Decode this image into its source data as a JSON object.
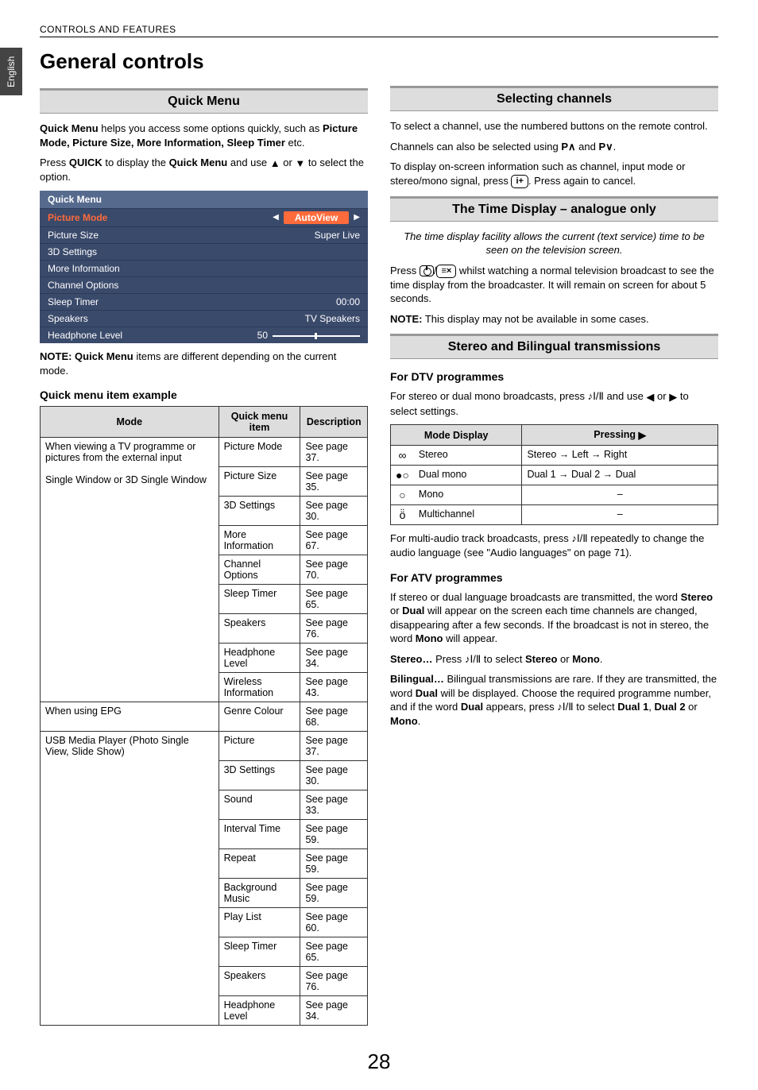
{
  "sideTab": "English",
  "header": "CONTROLS AND FEATURES",
  "h1": "General controls",
  "quickMenu": {
    "title": "Quick Menu",
    "intro": {
      "pre": "Quick Menu",
      "rest": " helps you access some options quickly, such as ",
      "bolds": "Picture Mode, Picture Size, More Information, Sleep Timer",
      "post": " etc."
    },
    "pressLine": {
      "pre": "Press ",
      "quick": "QUICK",
      "mid": " to display the ",
      "qm": "Quick Menu",
      "rest": " and use ",
      "post": " to select the option."
    },
    "osd": {
      "header": "Quick Menu",
      "rows": [
        {
          "label": "Picture Mode",
          "value": "AutoView",
          "highlight": true,
          "pill": true,
          "arrows": true
        },
        {
          "label": "Picture Size",
          "value": "Super Live"
        },
        {
          "label": "3D Settings",
          "value": ""
        },
        {
          "label": "More Information",
          "value": ""
        },
        {
          "label": "Channel Options",
          "value": ""
        },
        {
          "label": "Sleep Timer",
          "value": "00:00"
        },
        {
          "label": "Speakers",
          "value": "TV Speakers"
        },
        {
          "label": "Headphone Level",
          "value": "50",
          "slider": true
        }
      ]
    },
    "note": {
      "pre": "NOTE: Quick Menu",
      "rest": " items are different depending on the current mode."
    },
    "exampleTitle": "Quick menu item example",
    "tableHeaders": [
      "Mode",
      "Quick menu item",
      "Description"
    ],
    "group1Mode": "When viewing a TV programme or pictures from the external input\n\nSingle Window or 3D Single Window",
    "group1": [
      {
        "item": "Picture Mode",
        "desc": "See page 37."
      },
      {
        "item": "Picture Size",
        "desc": "See page 35."
      },
      {
        "item": "3D Settings",
        "desc": "See page 30."
      },
      {
        "item": "More Information",
        "desc": "See page 67."
      },
      {
        "item": "Channel Options",
        "desc": "See page 70."
      },
      {
        "item": "Sleep Timer",
        "desc": "See page 65."
      },
      {
        "item": "Speakers",
        "desc": "See page 76."
      },
      {
        "item": "Headphone  Level",
        "desc": "See page 34."
      },
      {
        "item": "Wireless Information",
        "desc": "See page 43."
      }
    ],
    "group2Mode": "When using EPG",
    "group2": [
      {
        "item": "Genre Colour",
        "desc": "See page 68."
      }
    ],
    "group3Mode": "USB Media Player (Photo Single View, Slide Show)",
    "group3": [
      {
        "item": "Picture",
        "desc": "See page 37."
      },
      {
        "item": "3D Settings",
        "desc": "See page 30."
      },
      {
        "item": "Sound",
        "desc": "See page 33."
      },
      {
        "item": "Interval Time",
        "desc": "See page 59."
      },
      {
        "item": "Repeat",
        "desc": "See page 59."
      },
      {
        "item": "Background Music",
        "desc": "See page 59."
      },
      {
        "item": "Play List",
        "desc": "See page 60."
      },
      {
        "item": "Sleep Timer",
        "desc": "See page 65."
      },
      {
        "item": "Speakers",
        "desc": "See page 76."
      },
      {
        "item": "Headphone  Level",
        "desc": "See page 34."
      }
    ]
  },
  "selecting": {
    "title": "Selecting channels",
    "p1": "To select a channel, use the numbered buttons on the remote control.",
    "p2pre": "Channels can also be selected using ",
    "p2a": "P",
    "p2and": " and ",
    "p2b": "P",
    "p2post": ".",
    "p3pre": "To display on-screen information such as channel, input mode or stereo/mono signal, press ",
    "btn": "i+",
    "p3post": ". Press again to cancel."
  },
  "timeDisplay": {
    "titlePre": "The Time Display – ",
    "titleBold": "analogue",
    "titlePost": " only",
    "italic": "The time display facility allows the current (text service) time to be seen on the television screen.",
    "p1pre": "Press ",
    "p1post": " whilst watching a normal television broadcast to see the time display from the broadcaster. It will remain on screen for about 5 seconds.",
    "note": {
      "pre": "NOTE:",
      "rest": " This display may not be available in some cases."
    }
  },
  "stereo": {
    "title": "Stereo and Bilingual transmissions",
    "dtvHead": "For DTV programmes",
    "dtvP1pre": "For stereo or dual mono broadcasts, press ",
    "dtvP1mid": " and use ",
    "dtvP1post": " to select settings.",
    "tableHeaders": [
      "Mode Display",
      "Pressing"
    ],
    "rows": [
      {
        "iconKey": "stereo",
        "label": "Stereo",
        "press": "Stereo → Left → Right"
      },
      {
        "iconKey": "dualmono",
        "label": "Dual mono",
        "press": "Dual 1 → Dual 2 → Dual"
      },
      {
        "iconKey": "mono",
        "label": "Mono",
        "press": "–"
      },
      {
        "iconKey": "multi",
        "label": "Multichannel",
        "press": "–"
      }
    ],
    "multiP": {
      "pre": "For multi-audio track broadcasts, press ",
      "post": " repeatedly to change the audio language (see \"Audio languages\" on page 71)."
    },
    "atvHead": "For ATV programmes",
    "atvP1": {
      "pre": "If stereo or dual language broadcasts are transmitted, the word ",
      "b1": "Stereo",
      "mid1": " or ",
      "b2": "Dual",
      "mid2": " will appear on the screen each time channels are changed, disappearing after a few seconds. If the broadcast is not in stereo, the word ",
      "b3": "Mono",
      "post": " will appear."
    },
    "stereoLine": {
      "pre": "Stereo…",
      "mid": " Press ",
      "post": " to select ",
      "b1": "Stereo",
      "or": " or ",
      "b2": "Mono",
      "end": "."
    },
    "bilingual": {
      "pre": "Bilingual…",
      "t1": " Bilingual transmissions are rare. If they are transmitted, the word ",
      "b1": "Dual",
      "t2": " will be displayed. Choose the required programme number, and if the word ",
      "b2": "Dual",
      "t3": " appears, press ",
      "t4": " to select ",
      "b3": "Dual 1",
      "c1": ", ",
      "b4": "Dual 2",
      "c2": " or ",
      "b5": "Mono",
      "end": "."
    }
  },
  "pageNum": "28"
}
